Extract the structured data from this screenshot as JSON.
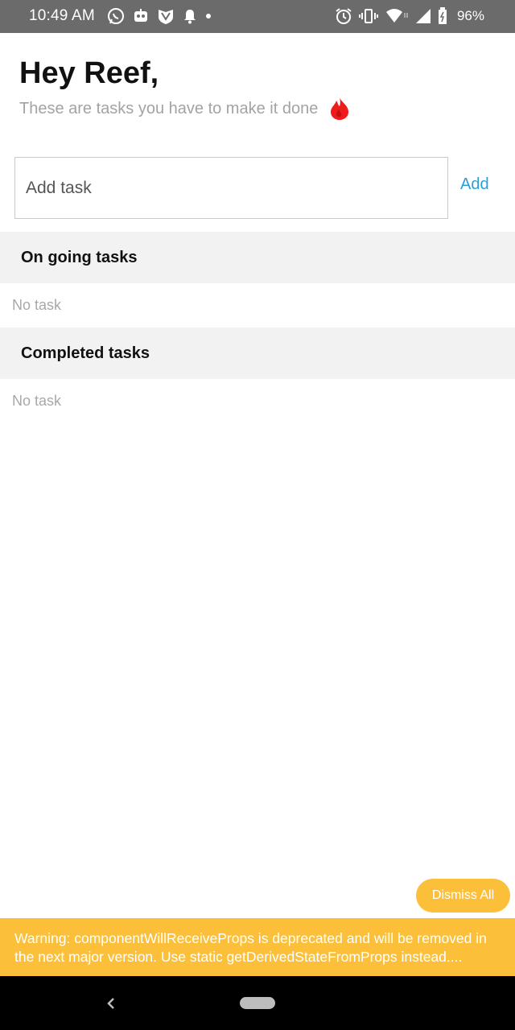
{
  "status_bar": {
    "time": "10:49 AM",
    "battery_percent": "96%",
    "left_icons": [
      "whatsapp-icon",
      "robot-app-icon",
      "vpn-shield-icon",
      "notification-bell-icon",
      "dot-icon"
    ],
    "right_icons": [
      "alarm-icon",
      "vibrate-icon",
      "wifi-icon",
      "signal-icon",
      "battery-icon"
    ],
    "background_color": "#6b6b6b"
  },
  "header": {
    "greeting": "Hey Reef,",
    "subtitle": "These are tasks you have to make it done",
    "subtitle_icon": "flame-icon"
  },
  "add_task": {
    "placeholder": "Add task",
    "value": "",
    "button_label": "Add",
    "button_color": "#2a9fd6"
  },
  "sections": {
    "ongoing": {
      "title": "On going tasks",
      "empty_text": "No task"
    },
    "completed": {
      "title": "Completed tasks",
      "empty_text": "No task"
    }
  },
  "warning": {
    "dismiss_label": "Dismiss All",
    "message": "Warning: componentWillReceiveProps is deprecated and will be removed in the next major version. Use static getDerivedStateFromProps instead....",
    "color": "#fbbf3a"
  },
  "nav_bar": {
    "back_icon": "back-chevron-icon",
    "home_icon": "home-pill-icon"
  }
}
